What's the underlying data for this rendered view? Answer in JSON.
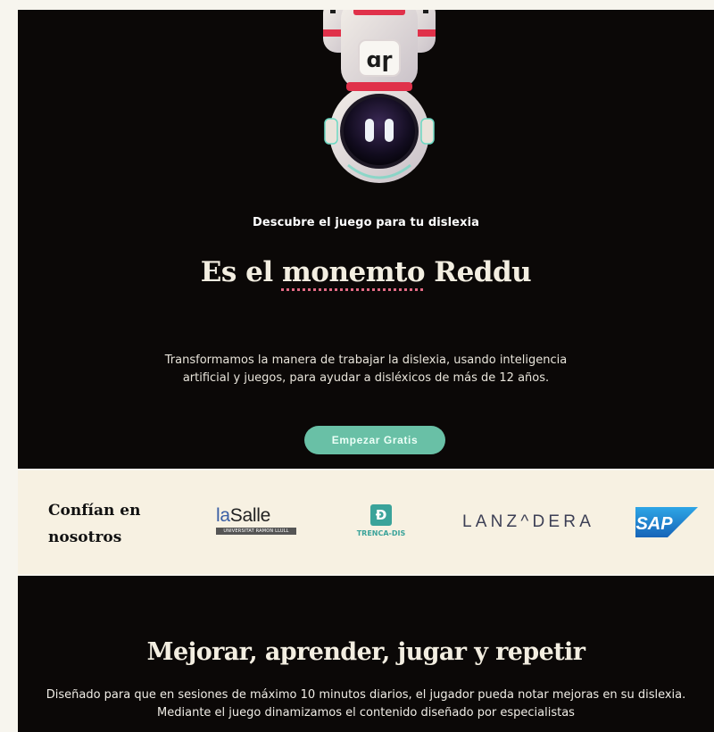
{
  "hero": {
    "eyebrow": "Descubre el juego para tu dislexia",
    "headline_before": "Es el ",
    "headline_misspelled": "monemto",
    "headline_after": " Reddu",
    "description_line1": "Transformamos la manera de trabajar la dislexia, usando inteligencia",
    "description_line2": "artificial y juegos, para ayudar a disléxicos de más de 12 años.",
    "cta_label": "Empezar Gratis",
    "astronaut_badge_text": "ɑɼ",
    "cta_color": "#69c0a6",
    "misspelling_underline_color": "#e36a84"
  },
  "trust": {
    "title_line1": "Confían en",
    "title_line2": "nosotros",
    "logos": {
      "lasalle_prefix": "la",
      "lasalle_suffix": "Salle",
      "lasalle_subtitle": "UNIVERSITAT RAMON LLULL",
      "trenca_glyph": "Ð",
      "trenca_label": "TRENCA-DIS",
      "lanzadera": "LANZ^DERA",
      "sap": "SAP"
    }
  },
  "features": {
    "title": "Mejorar, aprender, jugar y repetir",
    "desc_line1": "Diseñado para que en sesiones de máximo 10 minutos diarios, el jugador pueda notar mejoras en su dislexia.",
    "desc_line2": "Mediante el juego dinamizamos el contenido diseñado por especialistas"
  }
}
